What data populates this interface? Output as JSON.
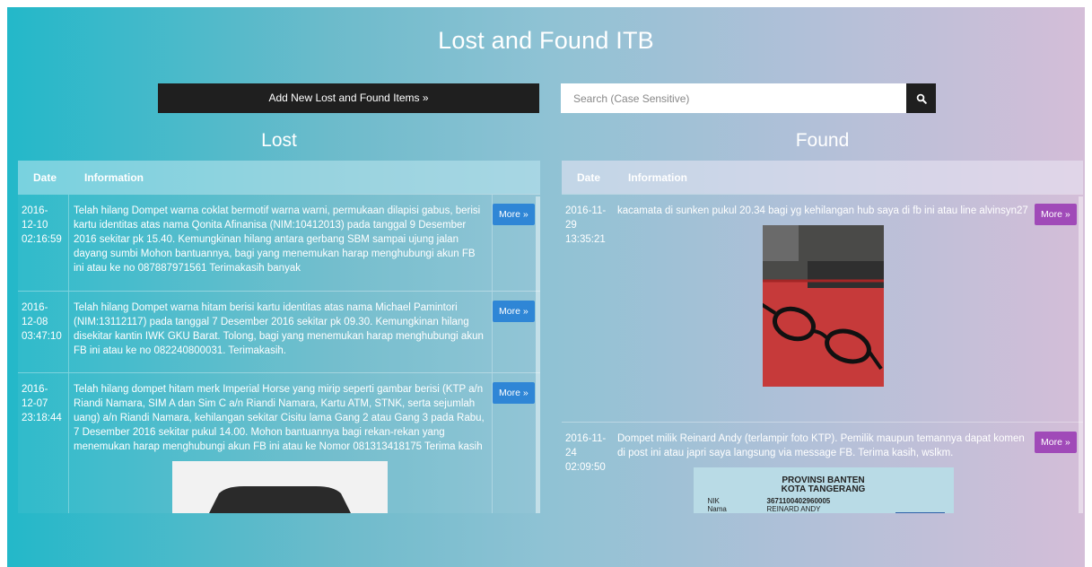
{
  "app": {
    "title": "Lost and Found ITB",
    "add_button": "Add New Lost and Found Items »",
    "search_placeholder": "Search (Case Sensitive)"
  },
  "lost": {
    "heading": "Lost",
    "col_date": "Date",
    "col_info": "Information",
    "items": [
      {
        "date": "2016-\n12-10\n02:16:59",
        "info": "Telah hilang Dompet warna coklat bermotif warna warni, permukaan dilapisi gabus, berisi kartu identitas atas nama Qonita Afinanisa (NIM:10412013) pada tanggal 9 Desember 2016 sekitar pk 15.40. Kemungkinan hilang antara gerbang SBM sampai ujung jalan dayang sumbi Mohon bantuannya, bagi yang menemukan harap menghubungi akun FB ini atau ke no 087887971561 Terimakasih banyak",
        "more": "More »"
      },
      {
        "date": "2016-\n12-08\n03:47:10",
        "info": "Telah hilang Dompet warna hitam berisi kartu identitas atas nama Michael Pamintori (NIM:13112117) pada tanggal 7 Desember 2016 sekitar pk 09.30. Kemungkinan hilang disekitar kantin IWK GKU Barat. Tolong, bagi yang menemukan harap menghubungi akun FB ini atau ke no 082240800031. Terimakasih.",
        "more": "More »"
      },
      {
        "date": "2016-\n12-07\n23:18:44",
        "info": "Telah hilang dompet hitam merk Imperial Horse yang mirip seperti gambar berisi (KTP a/n Riandi Namara, SIM A dan Sim C a/n Riandi Namara, Kartu ATM, STNK, serta sejumlah uang) a/n Riandi Namara, kehilangan sekitar Cisitu lama Gang 2 atau Gang 3 pada Rabu, 7 Desember 2016 sekitar pukul 14.00. Mohon bantuannya bagi rekan-rekan yang menemukan harap menghubungi akun FB ini atau ke Nomor 081313418175 Terima kasih",
        "more": "More »"
      }
    ]
  },
  "found": {
    "heading": "Found",
    "col_date": "Date",
    "col_info": "Information",
    "items": [
      {
        "date": "2016-11-\n29\n13:35:21",
        "info": "kacamata di sunken pukul 20.34 bagi yg kehilangan hub saya di fb ini atau line alvinsyn27",
        "more": "More »"
      },
      {
        "date": "2016-11-\n24\n02:09:50",
        "info": "Dompet milik Reinard Andy (terlampir foto KTP). Pemilik maupun temannya dapat komen di post ini atau japri saya langsung via message FB. Terima kasih, wslkm.",
        "more": "More »",
        "photo_text": {
          "province": "PROVINSI BANTEN",
          "city": "KOTA TANGERANG",
          "nik_label": "NIK",
          "nama_label": "Nama",
          "nik": "3671100402960005",
          "name": "REINARD ANDY"
        }
      }
    ]
  },
  "colors": {
    "lost_button": "#2f86d6",
    "found_button": "#a04ab8",
    "dark_button": "#1f1f1f"
  }
}
